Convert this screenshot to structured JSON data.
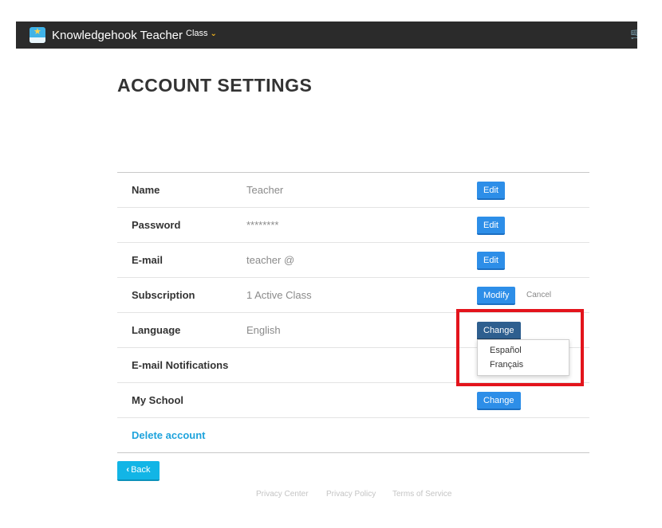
{
  "navbar": {
    "brand": "Knowledgehook Teacher",
    "class_menu": "Class",
    "icons": {
      "logo": "knowledgehook-logo-icon",
      "chevron": "chevron-down-icon",
      "cart": "cart-icon"
    },
    "colors": {
      "background": "#2b2b2b",
      "chevron": "#f3b51c",
      "cart": "#1e9be0"
    }
  },
  "page": {
    "title": "ACCOUNT SETTINGS"
  },
  "settings": {
    "rows": [
      {
        "label": "Name",
        "value": "Teacher",
        "button": "Edit"
      },
      {
        "label": "Password",
        "value": "********",
        "button": "Edit"
      },
      {
        "label": "E-mail",
        "value": "teacher @",
        "button": "Edit"
      },
      {
        "label": "Subscription",
        "value": "1 Active Class",
        "button": "Modify",
        "secondary": "Cancel"
      },
      {
        "label": "Language",
        "value": "English",
        "button": "Change"
      },
      {
        "label": "E-mail Notifications",
        "value": ""
      },
      {
        "label": "My School",
        "value": "",
        "button": "Change"
      }
    ],
    "delete_label": "Delete account"
  },
  "language_dropdown": {
    "options": [
      "Español",
      "Français"
    ]
  },
  "back_button": "Back",
  "footer": {
    "links": [
      "Privacy Center",
      "Privacy Policy",
      "Terms of Service"
    ]
  },
  "colors": {
    "primary_button": "#2d8ee8",
    "active_button": "#2e5f8f",
    "link": "#1ea3dc",
    "back_button": "#12b5e6",
    "highlight": "#e3141c"
  }
}
